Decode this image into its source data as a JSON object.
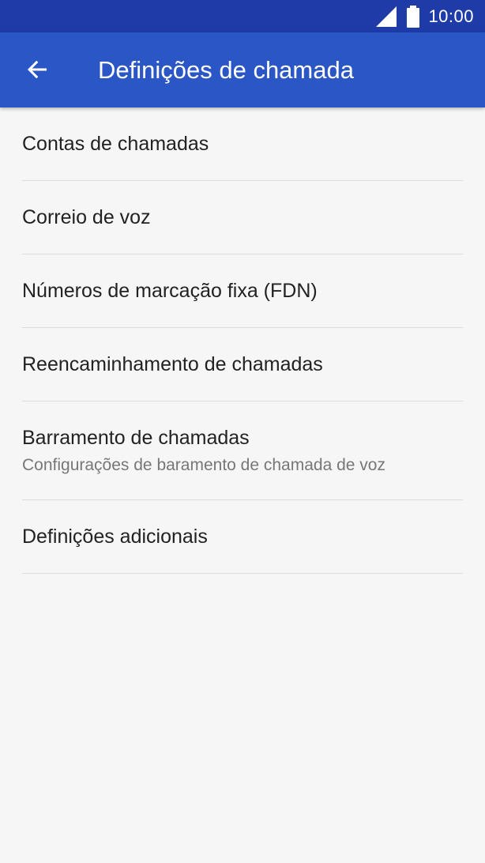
{
  "status_bar": {
    "time": "10:00",
    "icons": [
      "signal-icon",
      "battery-icon"
    ]
  },
  "app_bar": {
    "title": "Definições de chamada",
    "back_icon": "arrow-back-icon"
  },
  "settings_list": [
    {
      "title": "Contas de chamadas",
      "subtitle": ""
    },
    {
      "title": "Correio de voz",
      "subtitle": ""
    },
    {
      "title": "Números de marcação fixa (FDN)",
      "subtitle": ""
    },
    {
      "title": "Reencaminhamento de chamadas",
      "subtitle": ""
    },
    {
      "title": "Barramento de chamadas",
      "subtitle": "Configurações de baramento de chamada de voz"
    },
    {
      "title": "Definições adicionais",
      "subtitle": ""
    }
  ],
  "colors": {
    "status_bar": "#1e3ba8",
    "app_bar": "#2a56c6",
    "background": "#f6f6f6",
    "divider": "#dcdcdc",
    "primary_text": "#222222",
    "secondary_text": "#777777"
  }
}
